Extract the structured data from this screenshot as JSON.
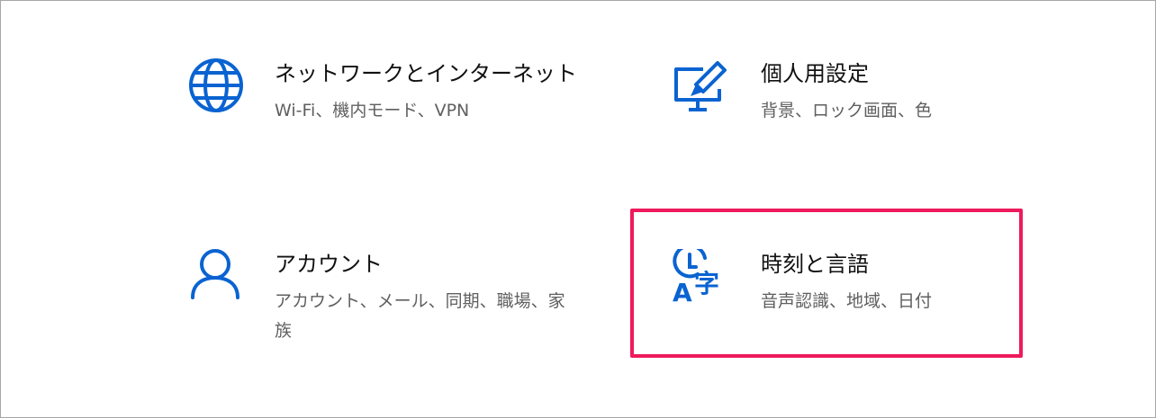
{
  "colors": {
    "accent": "#0a63d1",
    "highlight": "#ee1a5c",
    "title_text": "#111111",
    "desc_text": "#5f5f5f"
  },
  "tiles": [
    {
      "title": "ネットワークとインターネット",
      "description": "Wi-Fi、機内モード、VPN",
      "icon": "globe-icon"
    },
    {
      "title": "個人用設定",
      "description": "背景、ロック画面、色",
      "icon": "personalization-icon"
    },
    {
      "title": "アカウント",
      "description": "アカウント、メール、同期、職場、家族",
      "icon": "person-icon"
    },
    {
      "title": "時刻と言語",
      "description": "音声認識、地域、日付",
      "icon": "time-language-icon",
      "icon_glyphs": {
        "letter": "A",
        "kanji": "字"
      }
    }
  ]
}
